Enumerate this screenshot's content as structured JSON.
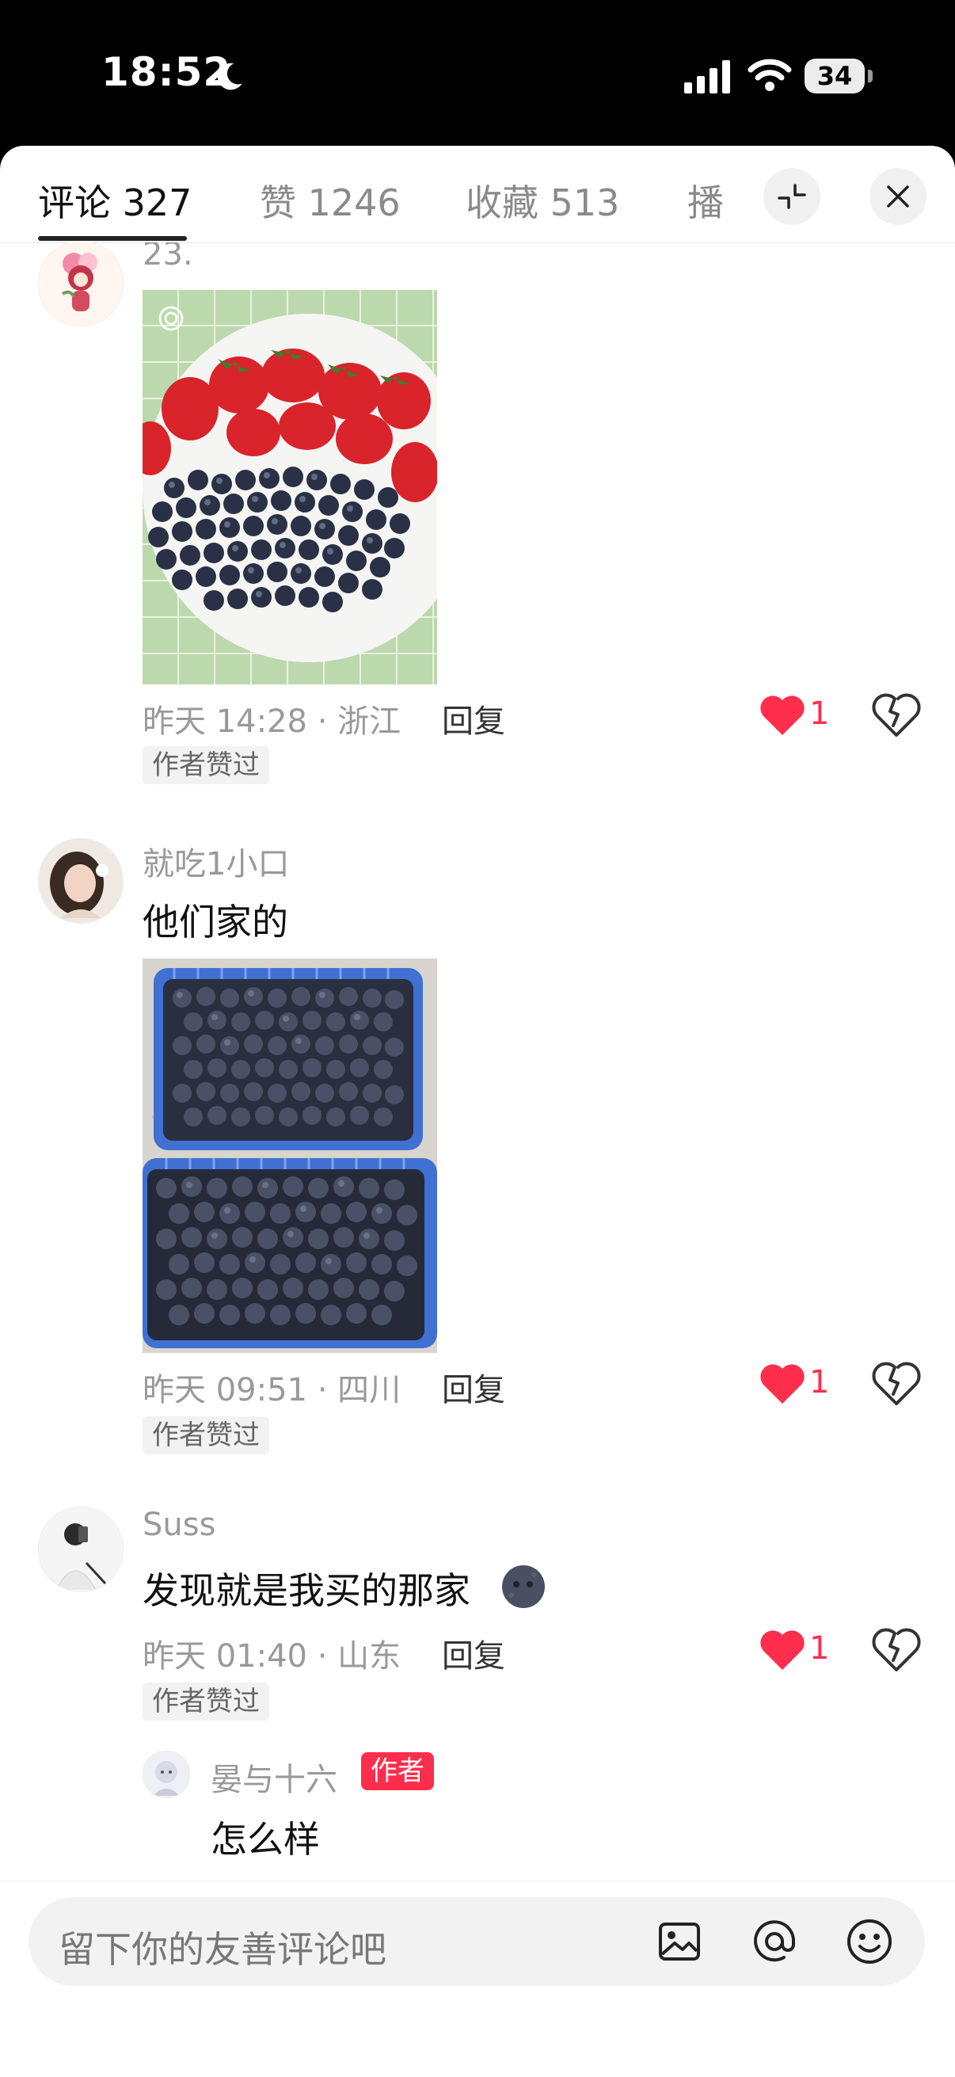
{
  "status_bar": {
    "time": "18:52",
    "battery": "34"
  },
  "tabs": [
    {
      "label": "评论 327",
      "active": true
    },
    {
      "label": "赞 1246",
      "active": false
    },
    {
      "label": "收藏 513",
      "active": false
    },
    {
      "label": "播",
      "active": false
    }
  ],
  "comments": [
    {
      "username": "",
      "text_fragment": "23.",
      "meta": "昨天 14:28 · 浙江",
      "reply_label": "回复",
      "likes": "1",
      "badge": "作者赞过"
    },
    {
      "username": "就吃1小口",
      "text": "他们家的",
      "meta": "昨天 09:51 · 四川",
      "reply_label": "回复",
      "likes": "1",
      "badge": "作者赞过"
    },
    {
      "username": "Suss",
      "text": "发现就是我买的那家",
      "meta": "昨天 01:40 · 山东",
      "reply_label": "回复",
      "likes": "1",
      "badge": "作者赞过",
      "reply": {
        "username": "晏与十六",
        "author_tag": "作者",
        "text": "怎么样"
      }
    }
  ],
  "input": {
    "placeholder": "留下你的友善评论吧"
  },
  "colors": {
    "accent": "#ff2e4d",
    "muted": "#999999"
  },
  "icons": {
    "minimize": "minimize-icon",
    "close": "close-icon",
    "like": "heart-icon",
    "dislike": "broken-heart-icon",
    "image": "image-icon",
    "mention": "at-icon",
    "emoji": "emoji-icon"
  }
}
